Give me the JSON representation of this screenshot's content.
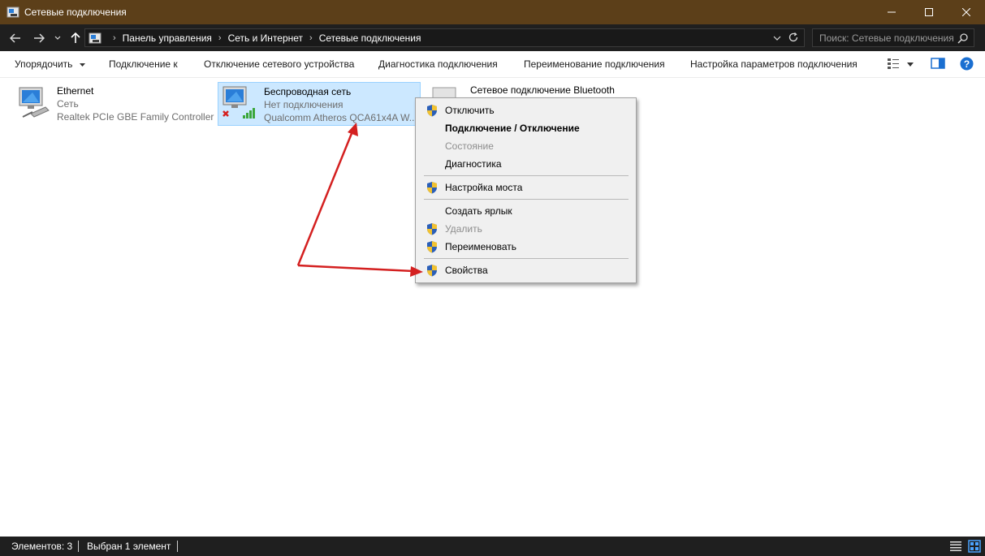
{
  "window": {
    "title": "Сетевые подключения"
  },
  "address": {
    "crumbs": [
      "Панель управления",
      "Сеть и Интернет",
      "Сетевые подключения"
    ],
    "search_placeholder": "Поиск: Сетевые подключения"
  },
  "toolbar": {
    "organize": "Упорядочить",
    "connect_to": "Подключение к",
    "disable_device": "Отключение сетевого устройства",
    "diagnose": "Диагностика подключения",
    "rename": "Переименование подключения",
    "change_settings": "Настройка параметров подключения"
  },
  "connections": [
    {
      "name": "Ethernet",
      "status": "Сеть",
      "device": "Realtek PCIe GBE Family Controller",
      "selected": false
    },
    {
      "name": "Беспроводная сеть",
      "status": "Нет подключения",
      "device": "Qualcomm Atheros QCA61x4A W...",
      "selected": true
    },
    {
      "name": "Сетевое подключение Bluetooth",
      "status": "",
      "device": "",
      "selected": false
    }
  ],
  "context_menu": {
    "items": [
      {
        "label": "Отключить",
        "shield": true,
        "bold": false,
        "disabled": false
      },
      {
        "label": "Подключение / Отключение",
        "shield": false,
        "bold": true,
        "disabled": false
      },
      {
        "label": "Состояние",
        "shield": false,
        "bold": false,
        "disabled": true
      },
      {
        "label": "Диагностика",
        "shield": false,
        "bold": false,
        "disabled": false
      },
      {
        "label": "Настройка моста",
        "shield": true,
        "bold": false,
        "disabled": false
      },
      {
        "label": "Создать ярлык",
        "shield": false,
        "bold": false,
        "disabled": false
      },
      {
        "label": "Удалить",
        "shield": true,
        "bold": false,
        "disabled": true
      },
      {
        "label": "Переименовать",
        "shield": true,
        "bold": false,
        "disabled": false
      },
      {
        "label": "Свойства",
        "shield": true,
        "bold": false,
        "disabled": false
      }
    ]
  },
  "status": {
    "count": "Элементов: 3",
    "selected": "Выбран 1 элемент"
  },
  "colors": {
    "titlebar": "#5c3f19",
    "dark_bar": "#1f1f1f",
    "selection": "#cce8ff",
    "annotation_arrow": "#d42020",
    "help_icon": "#1a6fd1"
  }
}
